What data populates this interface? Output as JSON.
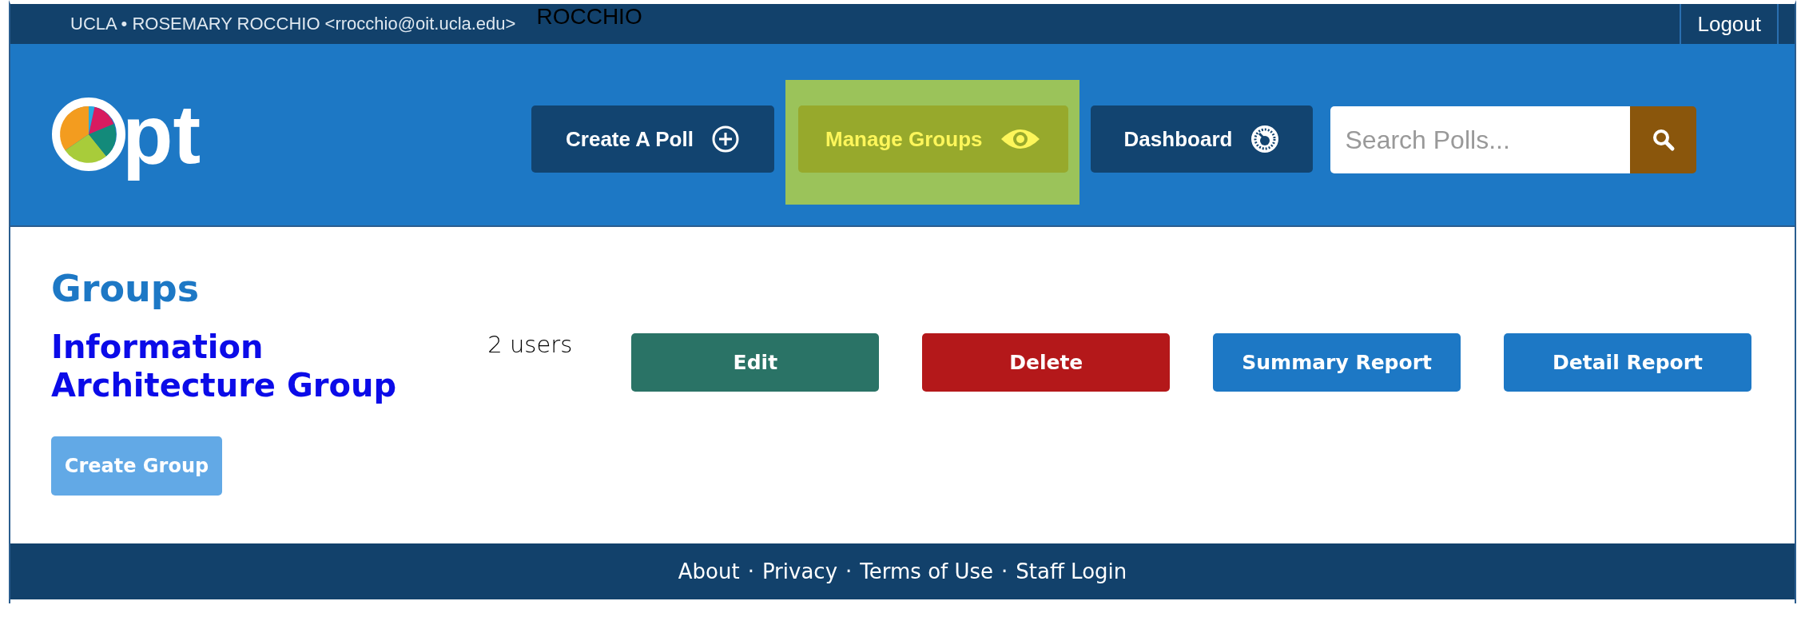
{
  "top_bar": {
    "user": "UCLA • ROSEMARY ROCCHIO <rrocchio@oit.ucla.edu>",
    "overlay_text": "ROCCHIO",
    "logout": "Logout"
  },
  "header": {
    "logo": "pt",
    "nav": [
      {
        "label": "Create A Poll",
        "kind": "plus",
        "selected": false
      },
      {
        "label": "Manage Groups",
        "kind": "eye",
        "selected": true
      },
      {
        "label": "Dashboard",
        "kind": "gauge",
        "selected": false
      }
    ],
    "search": {
      "placeholder": "Search Polls..."
    }
  },
  "page": {
    "title": "Groups",
    "groups": [
      {
        "name": "Information Architecture Group",
        "users": "2 users",
        "actions": [
          {
            "label": "Edit",
            "kind": "edit"
          },
          {
            "label": "Delete",
            "kind": "delete"
          },
          {
            "label": "Summary Report",
            "kind": "report"
          },
          {
            "label": "Detail Report",
            "kind": "report"
          }
        ]
      }
    ],
    "create_button": "Create Group"
  },
  "footer": {
    "separator": "·",
    "links": [
      "About",
      "Privacy",
      "Terms of Use",
      "Staff Login"
    ]
  }
}
